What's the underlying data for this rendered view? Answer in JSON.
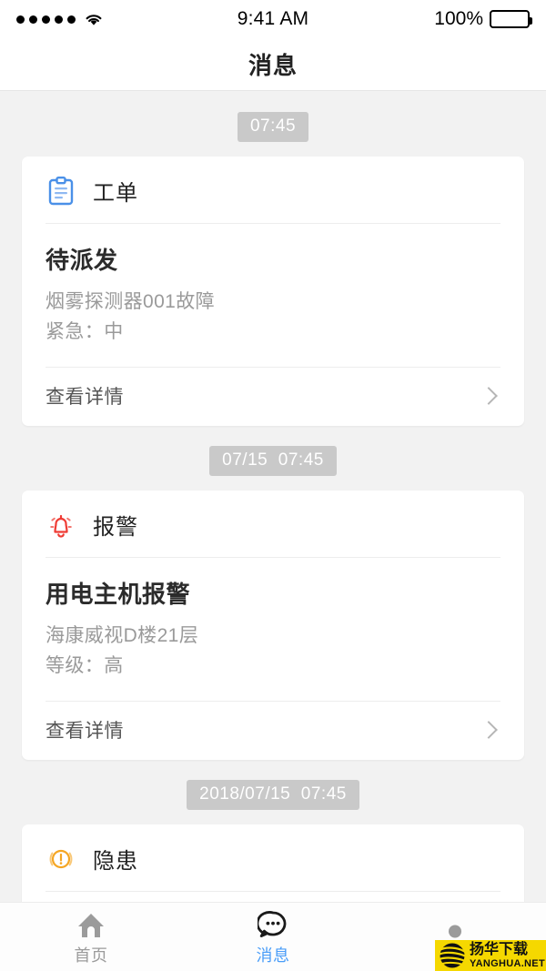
{
  "status_bar": {
    "signal_dots": 5,
    "wifi_icon": "wifi-icon",
    "time": "9:41 AM",
    "battery_percent": "100%",
    "battery_icon": "battery-full-icon"
  },
  "nav": {
    "title": "消息"
  },
  "colors": {
    "background": "#f2f2f2",
    "card": "#ffffff",
    "badge": "#c9c9c9",
    "work_order_icon": "#4a90e8",
    "alarm_icon": "#ef3b34",
    "hazard_icon": "#f5a623",
    "active_tab": "#4a9df8",
    "inactive_tab": "#9b9b9b",
    "watermark": "#f5d800"
  },
  "messages": [
    {
      "timestamp": "07:45",
      "icon": "clipboard-icon",
      "category": "工单",
      "title": "待派发",
      "detail_line_1": "烟雾探测器001故障",
      "detail_line_2": "紧急：中",
      "action_label": "查看详情",
      "chevron": "chevron-right-icon"
    },
    {
      "timestamp": "07/15  07:45",
      "icon": "bell-icon",
      "category": "报警",
      "title": "用电主机报警",
      "detail_line_1": "海康威视D楼21层",
      "detail_line_2": "等级：高",
      "action_label": "查看详情",
      "chevron": "chevron-right-icon"
    },
    {
      "timestamp": "2018/07/15  07:45",
      "icon": "warning-circle-icon",
      "category": "隐患",
      "title": "",
      "detail_line_1": "",
      "detail_line_2": "",
      "action_label": "",
      "chevron": "chevron-right-icon"
    }
  ],
  "tabbar": {
    "items": [
      {
        "icon": "home-icon",
        "label": "首页",
        "active": false
      },
      {
        "icon": "chat-bubble-icon",
        "label": "消息",
        "active": true
      },
      {
        "icon": "person-icon",
        "label": "",
        "active": false
      }
    ]
  },
  "watermark": {
    "logo": "yanghua-logo-icon",
    "title_cn": "扬华下载",
    "title_en": "YANGHUA.NET"
  }
}
